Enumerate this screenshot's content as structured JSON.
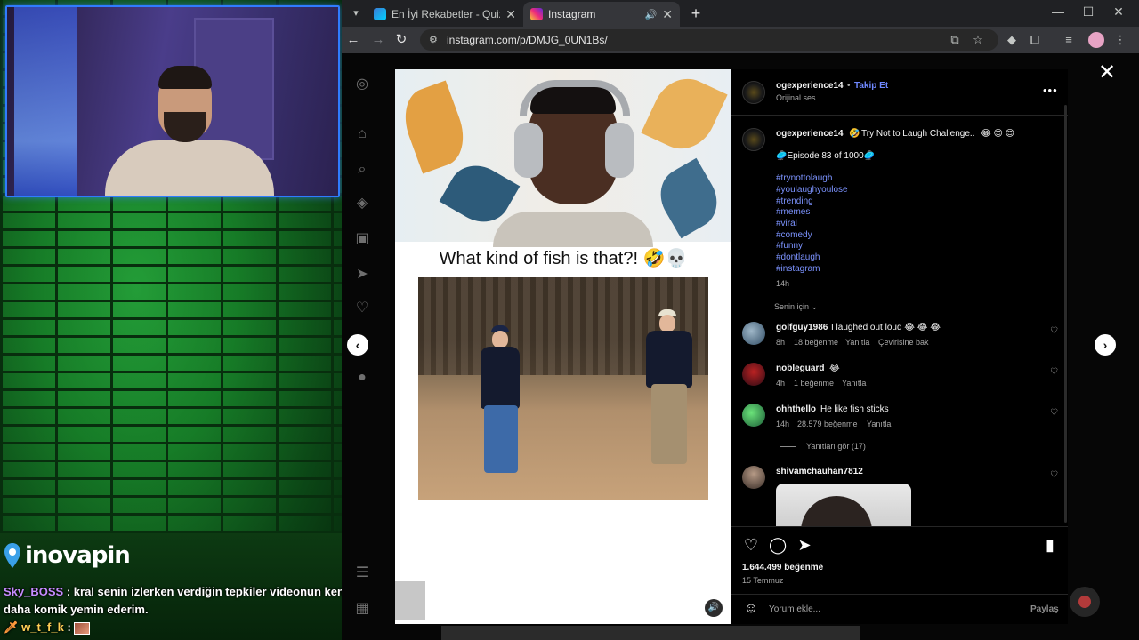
{
  "stream": {
    "logo_text": "inovapin",
    "chat": [
      {
        "user": "Sky_BOSS",
        "message": "kral senin izlerken verdiğin tepkiler videonun kendinden daha komik yemin ederim."
      },
      {
        "user": "w_t_f_k",
        "message": ""
      }
    ]
  },
  "browser": {
    "tabs": [
      {
        "title": "En İyi Rekabetler - Quizei",
        "active": false
      },
      {
        "title": "Instagram",
        "active": true
      }
    ],
    "url": "instagram.com/p/DMJG_0UN1Bs/",
    "window_controls": [
      "—",
      "☐",
      "✕"
    ]
  },
  "post": {
    "author": "ogexperience14",
    "follow_label": "Takip Et",
    "audio": "Orijinal ses",
    "caption_text": "Try Not to Laugh Challenge..",
    "caption_emojis": "😂 😍 😍",
    "episode": "🥏Episode 83 of 1000🥏",
    "hashtags": [
      "#trynottolaugh",
      "#youlaughyoulose",
      "#trending",
      "#memes",
      "#viral",
      "#comedy",
      "#funny",
      "#dontlaugh",
      "#instagram"
    ],
    "caption_time": "14h",
    "sort_label": "Senin için",
    "media_caption": "What kind of fish is that?! 🤣💀",
    "likes": "1.644.499 beğenme",
    "date": "15 Temmuz",
    "comment_placeholder": "Yorum ekle...",
    "share_label": "Paylaş"
  },
  "comments": [
    {
      "user": "golfguy1986",
      "text": "I laughed out loud 😂 😂 😂",
      "time": "8h",
      "likes": "18 beğenme",
      "reply": "Yanıtla",
      "translate": "Çevirisine bak"
    },
    {
      "user": "nobleguard",
      "text": "😂",
      "time": "4h",
      "likes": "1 beğenme",
      "reply": "Yanıtla"
    },
    {
      "user": "ohhthello",
      "text": "He like fish sticks",
      "time": "14h",
      "likes": "28.579 beğenme",
      "reply": "Yanıtla",
      "view_replies": "Yanıtları gör (17)"
    },
    {
      "user": "shivamchauhan7812",
      "text": ""
    }
  ],
  "colors": {
    "accent_blue": "#6f88ff",
    "hashtag": "#7c93ff",
    "stream_green": "#1ea534",
    "webcam_border": "#2f7cff"
  },
  "icons": {
    "rail": [
      "instagram-icon",
      "home-icon",
      "search-icon",
      "explore-icon",
      "reels-icon",
      "messages-icon",
      "notifications-icon",
      "create-icon",
      "menu-icon",
      "more-icon"
    ]
  }
}
